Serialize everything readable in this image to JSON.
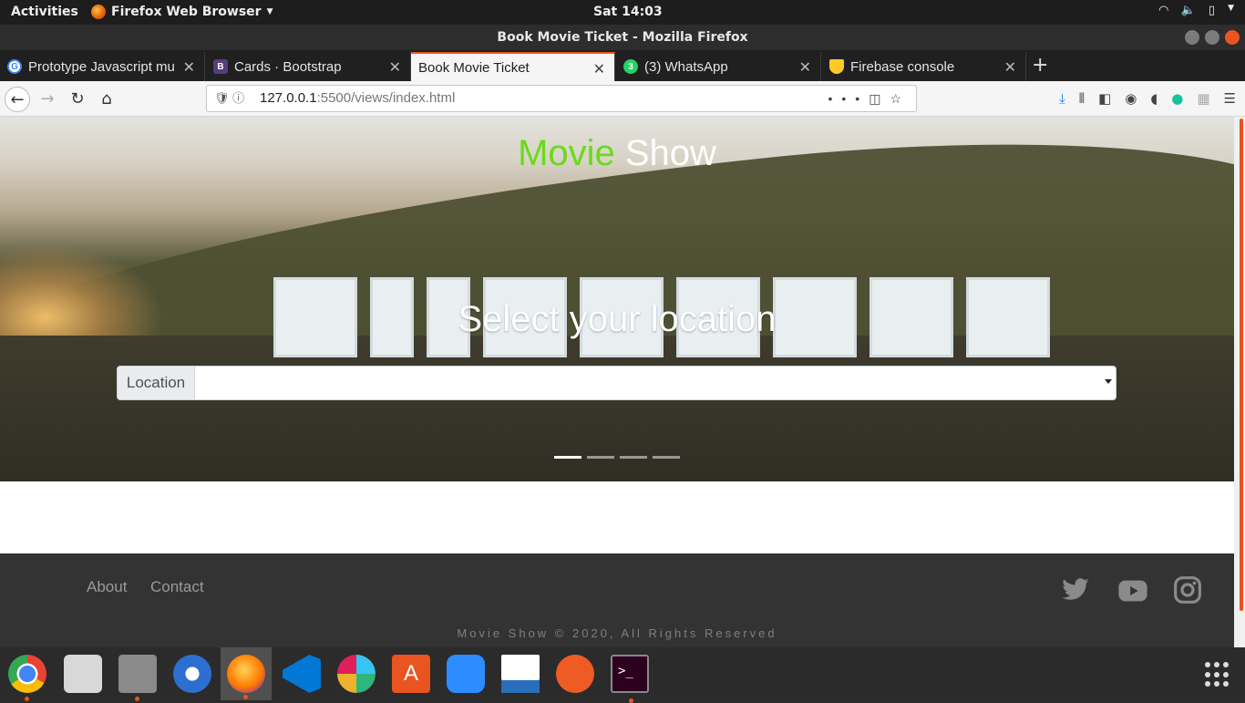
{
  "system": {
    "activities": "Activities",
    "app_name": "Firefox Web Browser",
    "clock": "Sat 14:03"
  },
  "window": {
    "title": "Book Movie Ticket - Mozilla Firefox"
  },
  "tabs": [
    {
      "label": "Prototype Javascript mu",
      "icon": "chrome-g-icon",
      "color": "#4285f4"
    },
    {
      "label": "Cards · Bootstrap",
      "icon": "bootstrap-icon",
      "color": "#563d7c"
    },
    {
      "label": "Book Movie Ticket",
      "icon": "",
      "color": ""
    },
    {
      "label": "(3) WhatsApp",
      "icon": "whatsapp-icon",
      "color": "#25d366",
      "badge": "3"
    },
    {
      "label": "Firebase console",
      "icon": "firebase-icon",
      "color": "#ffca28"
    }
  ],
  "url": {
    "host": "127.0.0.1",
    "rest": ":5500/views/index.html"
  },
  "page": {
    "brand_part1": "Movie",
    "brand_part2": " Show",
    "hero_title": "Select your location",
    "location_label": "Location",
    "location_value": "",
    "carousel_count": 4,
    "carousel_active": 0
  },
  "footer": {
    "links": [
      "About",
      "Contact"
    ],
    "social": [
      "twitter-icon",
      "youtube-icon",
      "instagram-icon"
    ],
    "copyright": "Movie Show © 2020, All Rights Reserved"
  },
  "dock": [
    "chrome-icon",
    "rhythmbox-icon",
    "files-icon",
    "thunderbird-icon",
    "firefox-icon",
    "vscode-icon",
    "slack-icon",
    "software-icon",
    "zoom-icon",
    "writer-icon",
    "postman-icon",
    "terminal-icon"
  ],
  "colors": {
    "accent": "#e95420",
    "brand_green": "#6ada1c"
  }
}
